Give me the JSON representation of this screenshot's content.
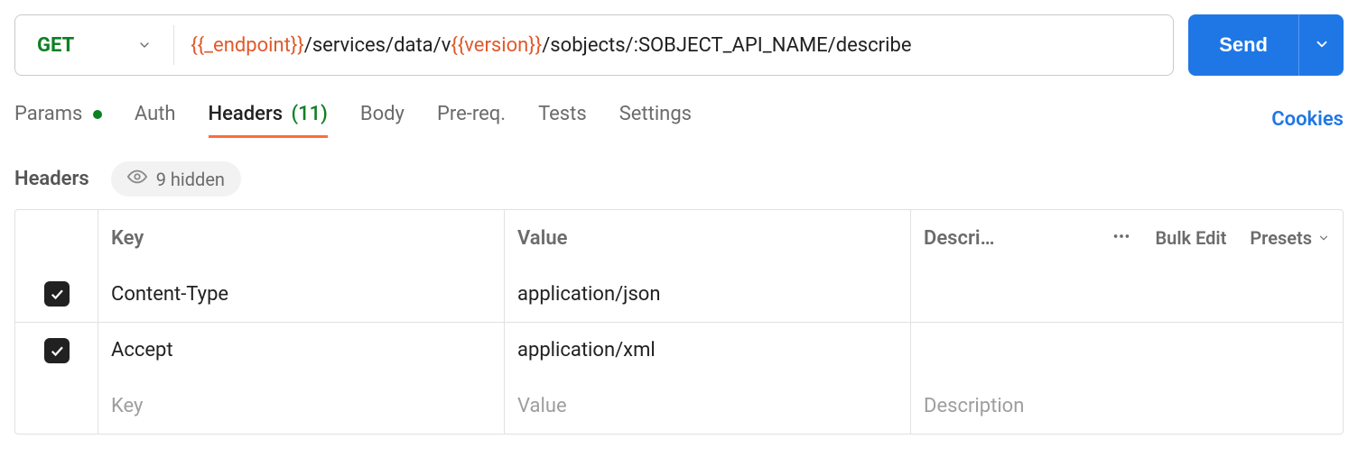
{
  "request": {
    "method": "GET",
    "url": {
      "segments": [
        {
          "type": "var",
          "text": "{{_endpoint}}"
        },
        {
          "type": "plain",
          "text": "/services/data/v"
        },
        {
          "type": "var",
          "text": "{{version}}"
        },
        {
          "type": "plain",
          "text": "/sobjects/:SOBJECT_API_NAME/describe"
        }
      ]
    },
    "send_label": "Send"
  },
  "tabs": {
    "params": {
      "label": "Params",
      "has_dot": true
    },
    "auth": {
      "label": "Auth"
    },
    "headers": {
      "label": "Headers",
      "count": "(11)"
    },
    "body": {
      "label": "Body"
    },
    "prereq": {
      "label": "Pre-req."
    },
    "tests": {
      "label": "Tests"
    },
    "settings": {
      "label": "Settings"
    },
    "cookies": {
      "label": "Cookies"
    }
  },
  "headers_section": {
    "title": "Headers",
    "hidden_label": "9 hidden",
    "columns": {
      "key": "Key",
      "value": "Value",
      "description": "Descri…",
      "bulk_edit": "Bulk Edit",
      "presets": "Presets"
    },
    "placeholders": {
      "key": "Key",
      "value": "Value",
      "description": "Description"
    },
    "rows": [
      {
        "enabled": true,
        "key": "Content-Type",
        "value": "application/json",
        "description": ""
      },
      {
        "enabled": true,
        "key": "Accept",
        "value": "application/xml",
        "description": ""
      }
    ]
  }
}
